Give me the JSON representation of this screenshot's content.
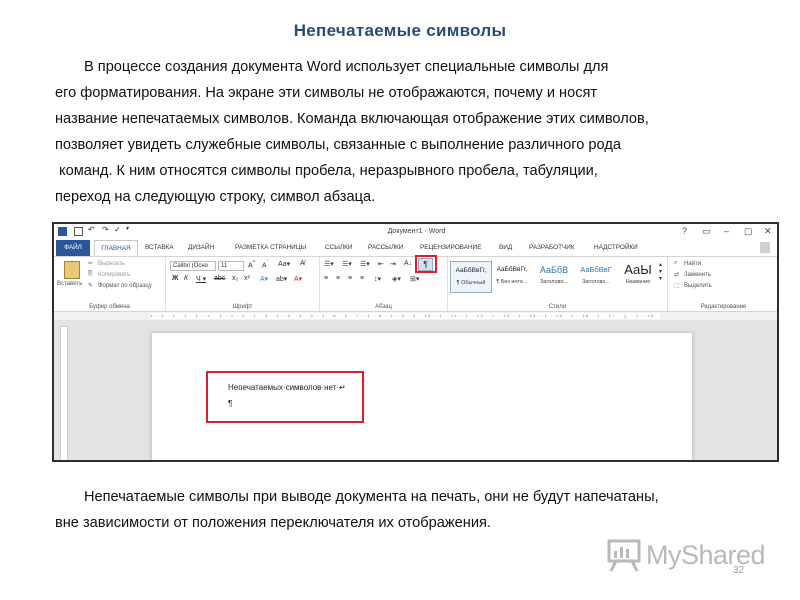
{
  "title": "Непечатаемые символы",
  "paragraph1": [
    "В процессе создания документа Word использует специальные символы для",
    "его форматирования. На экране эти символы не отображаются, почему и носят",
    "название непечатаемых символов. Команда включающая отображение этих символов,",
    "позволяет увидеть служебные символы, связанные с выполнение различного рода",
    " команд. К ним относятся символы пробела, неразрывного пробела, табуляции,",
    "переход на следующую строку, символ абзаца."
  ],
  "paragraph2": [
    "Непечатаемые символы при выводе документа на печать, они не будут напечатаны,",
    "вне зависимости от положения переключателя их отображения."
  ],
  "screenshot": {
    "window_title": "Документ1 - Word",
    "window_controls": [
      "?",
      "▭",
      "–",
      "▢",
      "✕"
    ],
    "tabs": [
      "ФАЙЛ",
      "ГЛАВНАЯ",
      "ВСТАВКА",
      "ДИЗАЙН",
      "РАЗМЕТКА СТРАНИЦЫ",
      "ССЫЛКИ",
      "РАССЫЛКИ",
      "РЕЦЕНЗИРОВАНИЕ",
      "ВИД",
      "РАЗРАБОТЧИК",
      "НАДСТРОЙКИ"
    ],
    "clipboard": {
      "paste": "Вставить",
      "cut": "Вырезать",
      "copy": "Копировать",
      "format_painter": "Формат по образцу",
      "label": "Буфер обмена"
    },
    "font": {
      "name": "Calibri (Осно",
      "size": "11",
      "label": "Шрифт"
    },
    "paragraph_label": "Абзац",
    "pilcrow_symbol": "¶",
    "styles": [
      {
        "sample": "АаБбВвГг,",
        "name": "¶ Обычный"
      },
      {
        "sample": "АаБбВвГг,",
        "name": "¶ Без инте..."
      },
      {
        "sample": "АаБбВ",
        "name": "Заголово..."
      },
      {
        "sample": "АаБбВвГ",
        "name": "Заголово..."
      },
      {
        "sample": "АаЫ",
        "name": "Название"
      }
    ],
    "styles_label": "Стили",
    "editing": {
      "find": "Найти",
      "replace": "Заменить",
      "select": "Выделить",
      "label": "Редактирование"
    },
    "ruler_text": "1 · 2 · 1 · 1 · 1 · ⊥ · 1 · 1 · 2 · 1 · 3 · 1 · 4 · 1 · 5 · 1 · 6 · 1 · 7 · 1 · 8 · 1 · 9 · 1 · 10 · 1 · 11 · 1 · 12 · 1 · 13 · 1 · 14 · 1 · 15 · 1 · 16 · 1 · 17 · △ · 1 · 18",
    "page_text": "Непечатаемых·символов·нет·↵",
    "page_pilcrow": "¶",
    "colors": {
      "file_tab": "#2b579a",
      "highlight": "#d9202b"
    }
  },
  "page_number": "32",
  "logo_text": "MyShared"
}
